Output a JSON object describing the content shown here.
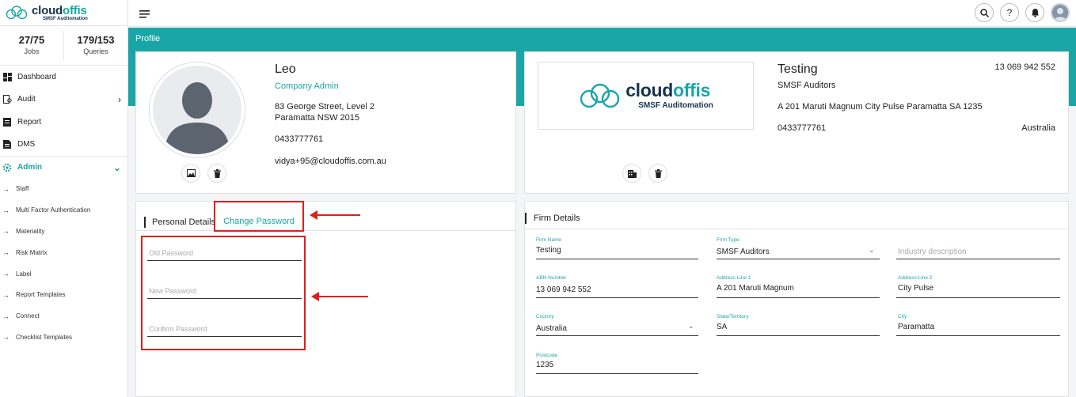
{
  "app": {
    "logo_name_a": "cloud",
    "logo_name_b": "offis",
    "logo_sub": "SMSF Auditomation"
  },
  "stats": [
    {
      "value": "27/75",
      "label": "Jobs"
    },
    {
      "value": "179/153",
      "label": "Queries"
    }
  ],
  "nav": {
    "dashboard": "Dashboard",
    "audit": "Audit",
    "report": "Report",
    "dms": "DMS",
    "admin": "Admin",
    "sub": [
      "Staff",
      "Multi Factor Authentication",
      "Materiality",
      "Risk Matrix",
      "Label",
      "Report Templates",
      "Connect",
      "Checklist Templates"
    ]
  },
  "page": {
    "title": "Profile"
  },
  "profile": {
    "name": "Leo",
    "role": "Company Admin",
    "address_line1": "83 George Street, Level 2",
    "address_line2": "Paramatta NSW 2015",
    "phone": "0433777761",
    "email": "vidya+95@cloudoffis.com.au"
  },
  "firm": {
    "name": "Testing",
    "type": "SMSF Auditors",
    "abn": "13 069 942 552",
    "address": "A 201 Maruti Magnum City Pulse Paramatta SA 1235",
    "phone": "0433777761",
    "country": "Australia",
    "logo_name_a": "cloud",
    "logo_name_b": "offis",
    "logo_sub": "SMSF Auditomation"
  },
  "tabs": {
    "personal": "Personal Details",
    "change_password": "Change Password"
  },
  "password_form": {
    "old": "Old Password",
    "new": "New Password",
    "confirm": "Confirm Password"
  },
  "firm_details": {
    "title": "Firm Details",
    "fields": {
      "firm_name": {
        "label": "Firm Name",
        "value": "Testing"
      },
      "firm_type": {
        "label": "Firm Type",
        "value": "SMSF Auditors"
      },
      "industry": {
        "placeholder": "Industry description"
      },
      "abn": {
        "label": "ABN Number",
        "value": "13 069 942 552"
      },
      "addr1": {
        "label": "Address Line 1",
        "value": "A 201 Maruti Magnum"
      },
      "addr2": {
        "label": "Address Line 2",
        "value": "City Pulse"
      },
      "country": {
        "label": "Country",
        "value": "Australia"
      },
      "state": {
        "label": "State/Territory",
        "value": "SA"
      },
      "city": {
        "label": "City",
        "value": "Paramatta"
      },
      "postcode": {
        "label": "Postcode",
        "value": "1235"
      }
    }
  },
  "colors": {
    "accent": "#1aa6a6",
    "annotation": "#e01e1e",
    "brand_dark": "#16324f"
  }
}
